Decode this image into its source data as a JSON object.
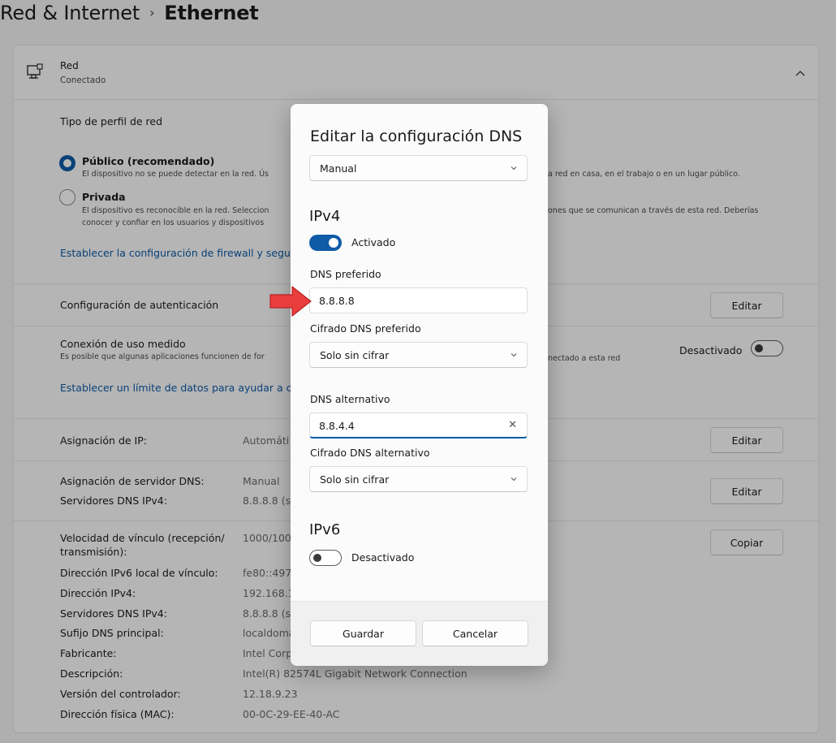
{
  "breadcrumb": {
    "parent": "Red & Internet",
    "separator": "›",
    "current": "Ethernet"
  },
  "network": {
    "name": "Red",
    "status": "Conectado"
  },
  "profile": {
    "heading": "Tipo de perfil de red",
    "public_label": "Público (recomendado)",
    "public_desc": "El dispositivo no se puede detectar en la red. Ús",
    "public_desc_right": "a red en casa, en el trabajo o en un lugar público.",
    "private_label": "Privada",
    "private_desc_1": "El dispositivo es reconocible en la red. Seleccion",
    "private_desc_1_right": "ones que se comunican a través de esta red. Deberías",
    "private_desc_2": "conocer y confiar en los usuarios y dispositivos",
    "firewall_link": "Establecer la configuración de firewall y seguri"
  },
  "auth": {
    "label": "Configuración de autenticación",
    "edit": "Editar"
  },
  "metered": {
    "label": "Conexión de uso medido",
    "desc": "Es posible que algunas aplicaciones funcionen de for",
    "desc_right": "nectado a esta red",
    "state": "Desactivado",
    "data_limit_link": "Establecer un límite de datos para ayudar a co"
  },
  "ip_assign": {
    "label": "Asignación de IP:",
    "value": "Automáti",
    "edit": "Editar"
  },
  "dns_assign": {
    "label": "Asignación de servidor DNS:",
    "value": "Manual",
    "ipv4_label": "Servidores DNS IPv4:",
    "ipv4_value": "8.8.8.8 (si",
    "edit": "Editar"
  },
  "properties": {
    "copy": "Copiar",
    "rows": [
      {
        "label": "Velocidad de vínculo (recepción/",
        "value": "1000/1000"
      },
      {
        "label": "transmisión):",
        "value": ""
      },
      {
        "label": "Dirección IPv6 local de vínculo:",
        "value": "fe80::4979"
      },
      {
        "label": "Dirección IPv4:",
        "value": "192.168.18"
      },
      {
        "label": "Servidores DNS IPv4:",
        "value": "8.8.8.8 (si"
      },
      {
        "label": "Sufijo DNS principal:",
        "value": "localdoma"
      },
      {
        "label": "Fabricante:",
        "value": "Intel Corp"
      },
      {
        "label": "Descripción:",
        "value": "Intel(R) 82574L Gigabit Network Connection"
      },
      {
        "label": "Versión del controlador:",
        "value": "12.18.9.23"
      },
      {
        "label": "Dirección física (MAC):",
        "value": "00-0C-29-EE-40-AC"
      }
    ]
  },
  "dialog": {
    "title": "Editar la configuración DNS",
    "mode": "Manual",
    "ipv4_heading": "IPv4",
    "ipv4_toggle": "Activado",
    "preferred_label": "DNS preferido",
    "preferred_value": "8.8.8.8",
    "preferred_enc_label": "Cifrado DNS preferido",
    "preferred_enc_value": "Solo sin cifrar",
    "alternate_label": "DNS alternativo",
    "alternate_value": "8.8.4.4",
    "alternate_enc_label": "Cifrado DNS alternativo",
    "alternate_enc_value": "Solo sin cifrar",
    "ipv6_heading": "IPv6",
    "ipv6_toggle": "Desactivado",
    "save": "Guardar",
    "cancel": "Cancelar"
  },
  "colors": {
    "accent": "#0f5ba7",
    "arrow": "#ea3d3d"
  }
}
